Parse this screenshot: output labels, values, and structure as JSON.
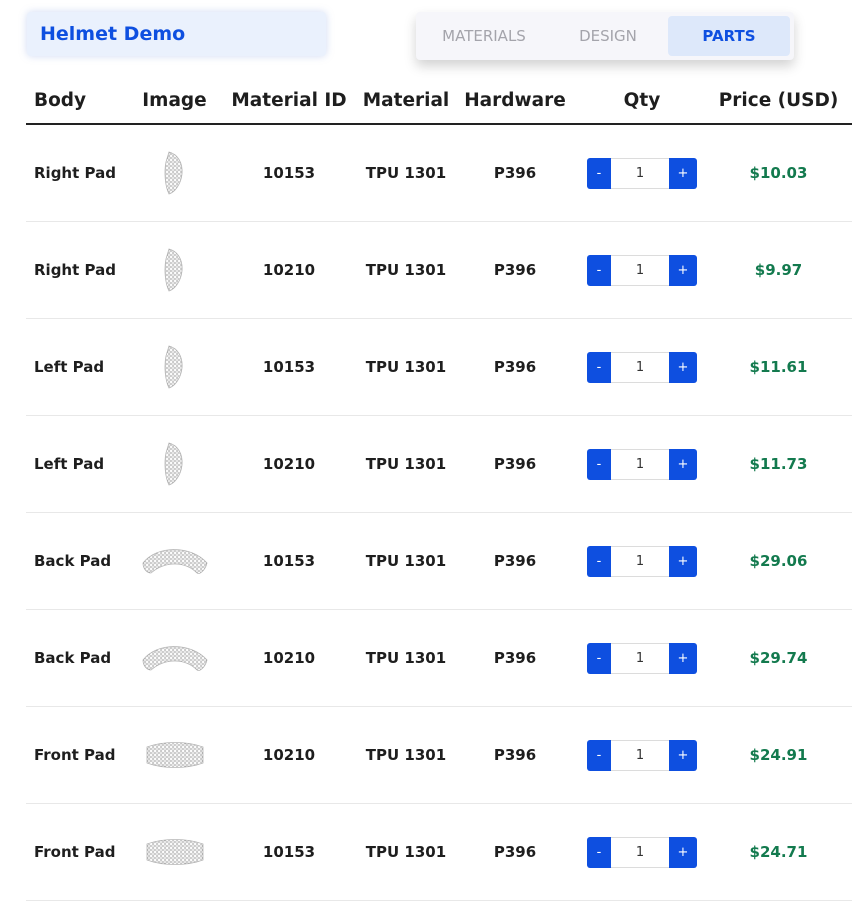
{
  "app": {
    "title": "Helmet Demo"
  },
  "tabs": [
    {
      "label": "MATERIALS",
      "active": false
    },
    {
      "label": "DESIGN",
      "active": false
    },
    {
      "label": "PARTS",
      "active": true
    }
  ],
  "table": {
    "headers": {
      "body": "Body",
      "image": "Image",
      "material_id": "Material ID",
      "material": "Material",
      "hardware": "Hardware",
      "qty": "Qty",
      "price": "Price (USD)"
    },
    "minus_label": "-",
    "plus_label": "+",
    "rows": [
      {
        "body": "Right Pad",
        "image_icon": "side-pad-thumbnail",
        "material_id": "10153",
        "material": "TPU 1301",
        "hardware": "P396",
        "qty": "1",
        "price": "$10.03"
      },
      {
        "body": "Right Pad",
        "image_icon": "side-pad-thumbnail",
        "material_id": "10210",
        "material": "TPU 1301",
        "hardware": "P396",
        "qty": "1",
        "price": "$9.97"
      },
      {
        "body": "Left Pad",
        "image_icon": "side-pad-thumbnail",
        "material_id": "10153",
        "material": "TPU 1301",
        "hardware": "P396",
        "qty": "1",
        "price": "$11.61"
      },
      {
        "body": "Left Pad",
        "image_icon": "side-pad-thumbnail",
        "material_id": "10210",
        "material": "TPU 1301",
        "hardware": "P396",
        "qty": "1",
        "price": "$11.73"
      },
      {
        "body": "Back Pad",
        "image_icon": "back-pad-thumbnail",
        "material_id": "10153",
        "material": "TPU 1301",
        "hardware": "P396",
        "qty": "1",
        "price": "$29.06"
      },
      {
        "body": "Back Pad",
        "image_icon": "back-pad-thumbnail",
        "material_id": "10210",
        "material": "TPU 1301",
        "hardware": "P396",
        "qty": "1",
        "price": "$29.74"
      },
      {
        "body": "Front Pad",
        "image_icon": "front-pad-thumbnail",
        "material_id": "10210",
        "material": "TPU 1301",
        "hardware": "P396",
        "qty": "1",
        "price": "$24.91"
      },
      {
        "body": "Front Pad",
        "image_icon": "front-pad-thumbnail",
        "material_id": "10153",
        "material": "TPU 1301",
        "hardware": "P396",
        "qty": "1",
        "price": "$24.71"
      }
    ]
  },
  "colors": {
    "accent": "#0e4fe0",
    "price": "#137a4e",
    "tab_active_bg": "#dde8fa",
    "title_bg": "#eaf1fd"
  }
}
